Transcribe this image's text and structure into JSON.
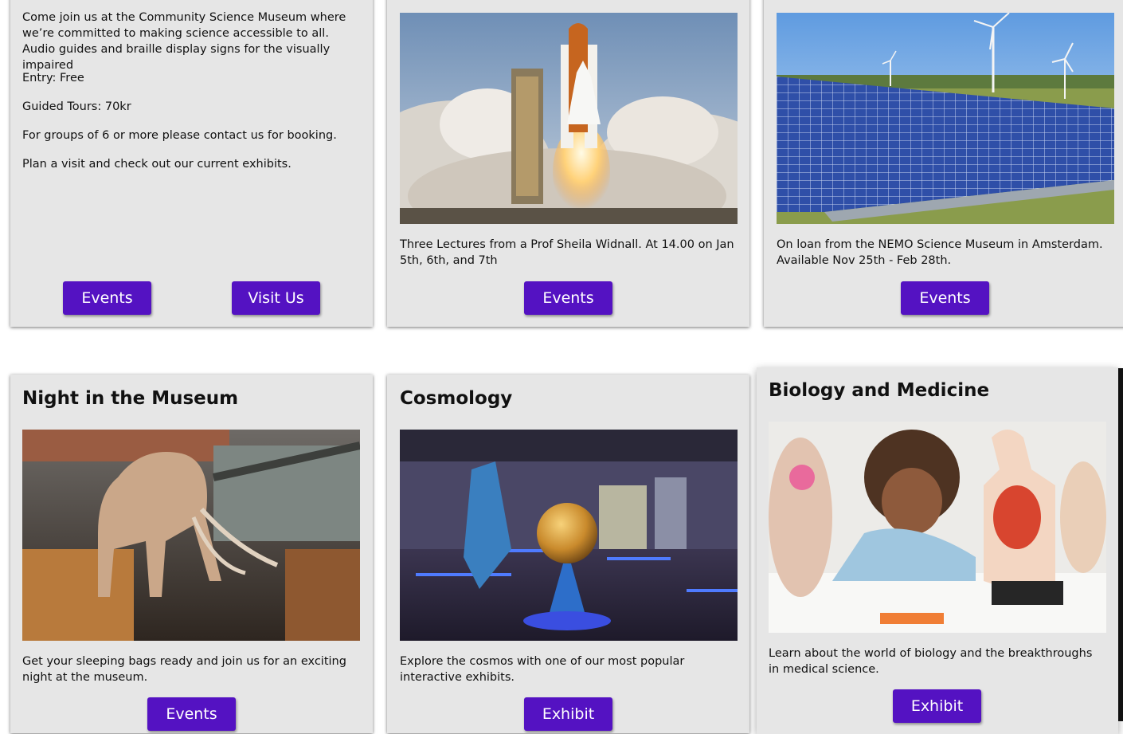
{
  "cards": {
    "intro": {
      "paragraph": "Come join us at the Community Science Museum where we’re committed to making science accessible to all. Audio guides and braille display signs for the visually impaired",
      "entry": "Entry: Free",
      "tours": "Guided Tours: 70kr",
      "groups": "For groups of 6 or more please contact us for booking.",
      "plan": "Plan a visit and check out our current exhibits.",
      "events_label": "Events",
      "visit_label": "Visit Us"
    },
    "lectures": {
      "image": "rocket-launch-photo",
      "text": "Three Lectures from a Prof Sheila Widnall. At 14.00 on Jan 5th, 6th, and 7th",
      "button_label": "Events"
    },
    "energy": {
      "image": "solar-panels-wind-turbines-photo",
      "text": "On loan from the NEMO Science Museum in Amsterdam. Available Nov 25th - Feb 28th.",
      "button_label": "Events"
    },
    "night": {
      "title": "Night in the Museum",
      "image": "mammoth-skeleton-photo",
      "text": "Get your sleeping bags ready and join us for an exciting night at the museum.",
      "button_label": "Events"
    },
    "cosmology": {
      "title": "Cosmology",
      "image": "planetarium-globe-photo",
      "text": "Explore the cosmos with one of our most popular interactive exhibits.",
      "button_label": "Exhibit"
    },
    "biology": {
      "title": "Biology and Medicine",
      "image": "children-anatomy-model-photo",
      "text": "Learn about the world of biology and the breakthroughs in medical science.",
      "button_label": "Exhibit"
    }
  },
  "colors": {
    "card_background": "#e6e6e6",
    "button_background": "#5412c2",
    "button_text": "#ffffff"
  }
}
